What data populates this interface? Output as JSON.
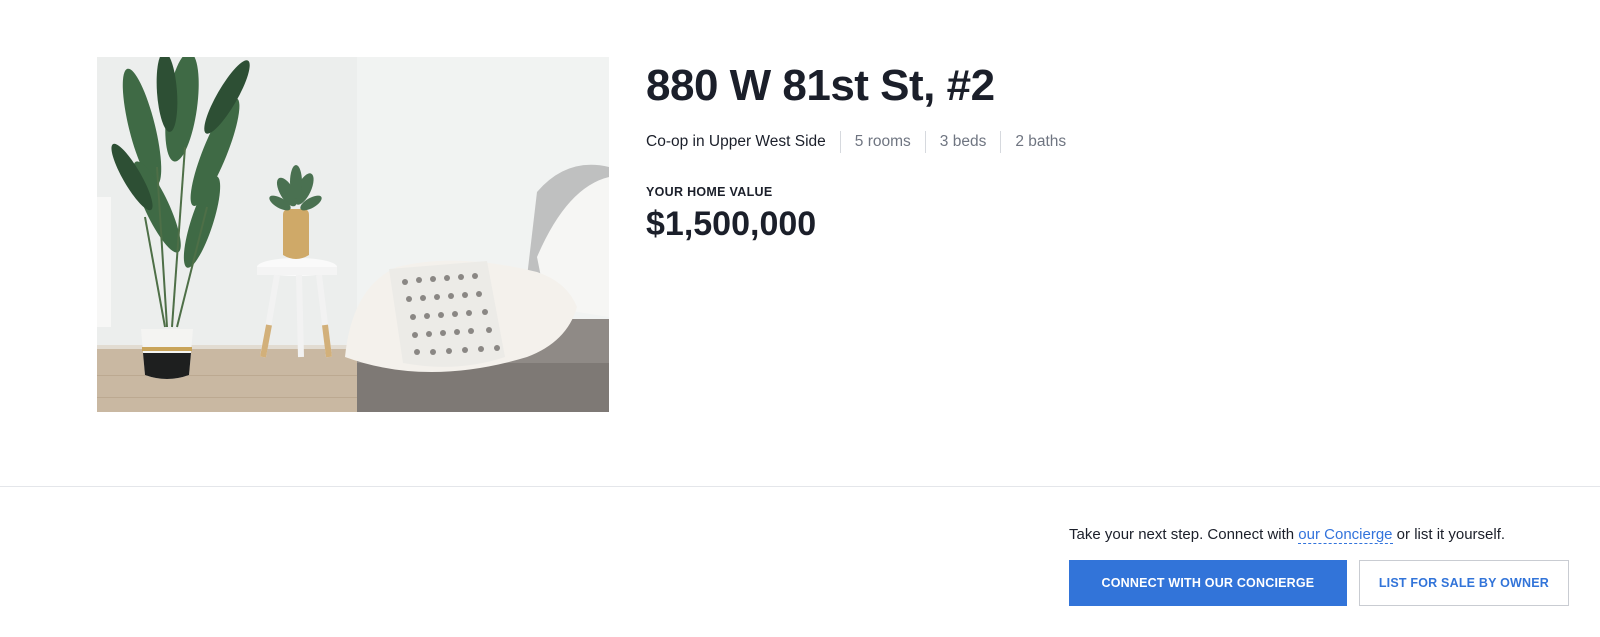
{
  "listing": {
    "photo_alt": "Living room with plant, side table and sofa",
    "address": "880 W 81st St, #2",
    "facts": [
      "Co-op in Upper West Side",
      "5 rooms",
      "3 beds",
      "2 baths"
    ],
    "value_label": "YOUR HOME VALUE",
    "value_amount": "$1,500,000"
  },
  "cta": {
    "text_before": "Take your next step. Connect with ",
    "link_label": "our Concierge",
    "text_after": " or list it yourself.",
    "primary_button": "CONNECT WITH OUR CONCIERGE",
    "secondary_button": "LIST FOR SALE BY OWNER"
  },
  "colors": {
    "accent": "#3274d9",
    "text": "#1b1f2a",
    "muted": "#6f7581"
  }
}
